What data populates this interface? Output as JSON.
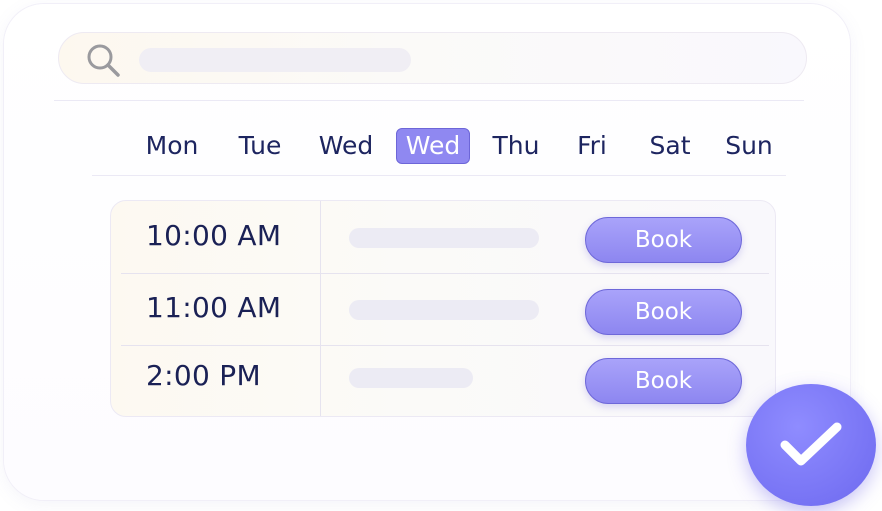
{
  "search": {
    "icon": "search-icon"
  },
  "days": [
    {
      "label": "Mon"
    },
    {
      "label": "Tue"
    },
    {
      "label": "Wed"
    },
    {
      "label": "Wed",
      "selected": true
    },
    {
      "label": "Thu"
    },
    {
      "label": "Fri"
    },
    {
      "label": "Sat"
    },
    {
      "label": "Sun"
    }
  ],
  "slots": [
    {
      "time": "10:00 AM",
      "action": "Book"
    },
    {
      "time": "11:00 AM",
      "action": "Book"
    },
    {
      "time": "2:00 PM",
      "action": "Book"
    }
  ],
  "confirm": {
    "icon": "checkmark-icon"
  },
  "colors": {
    "accent": "#8f88f1",
    "text": "#1d2560",
    "confirm": "#7773f4"
  }
}
